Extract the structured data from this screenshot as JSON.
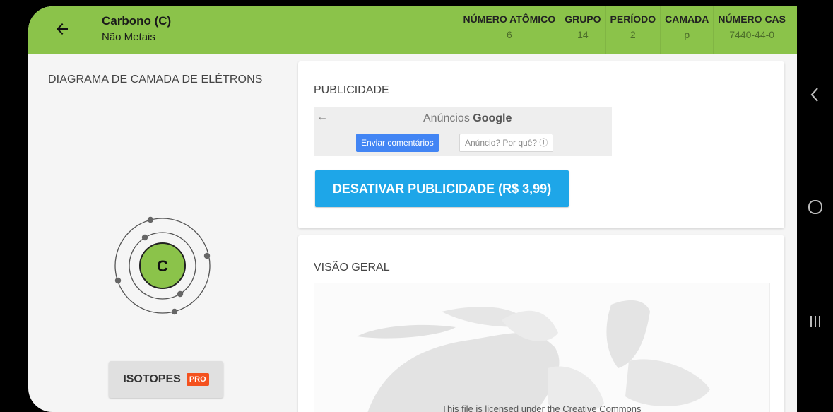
{
  "header": {
    "element_name": "Carbono (C)",
    "category": "Não Metais",
    "properties": [
      {
        "label": "NÚMERO ATÔMICO",
        "value": "6"
      },
      {
        "label": "GRUPO",
        "value": "14"
      },
      {
        "label": "PERÍODO",
        "value": "2"
      },
      {
        "label": "CAMADA",
        "value": "p"
      },
      {
        "label": "NÚMERO CAS",
        "value": "7440-44-0"
      }
    ],
    "bar_color": "#8bc34a"
  },
  "diagram": {
    "title": "DIAGRAMA DE CAMADA DE ELÉTRONS",
    "symbol": "C",
    "shells": [
      2,
      4
    ],
    "nucleus_color": "#8bc34a"
  },
  "isotopes": {
    "label": "ISOTOPES",
    "badge": "PRO"
  },
  "ads": {
    "title": "PUBLICIDADE",
    "brand_prefix": "Anúncios",
    "brand_name": "Google",
    "feedback_label": "Enviar comentários",
    "why_label": "Anúncio? Por quê? ⓘ",
    "disable_label": "DESATIVAR PUBLICIDADE (R$ 3,99)",
    "disable_color": "#1ea6e8"
  },
  "overview": {
    "title": "VISÃO GERAL",
    "caption": "This file is licensed under the Creative Commons"
  },
  "navigation": {
    "back_icon": "arrow-left-icon",
    "nav_icons": [
      "chevron-left-icon",
      "circle-icon",
      "recent-apps-icon"
    ]
  }
}
